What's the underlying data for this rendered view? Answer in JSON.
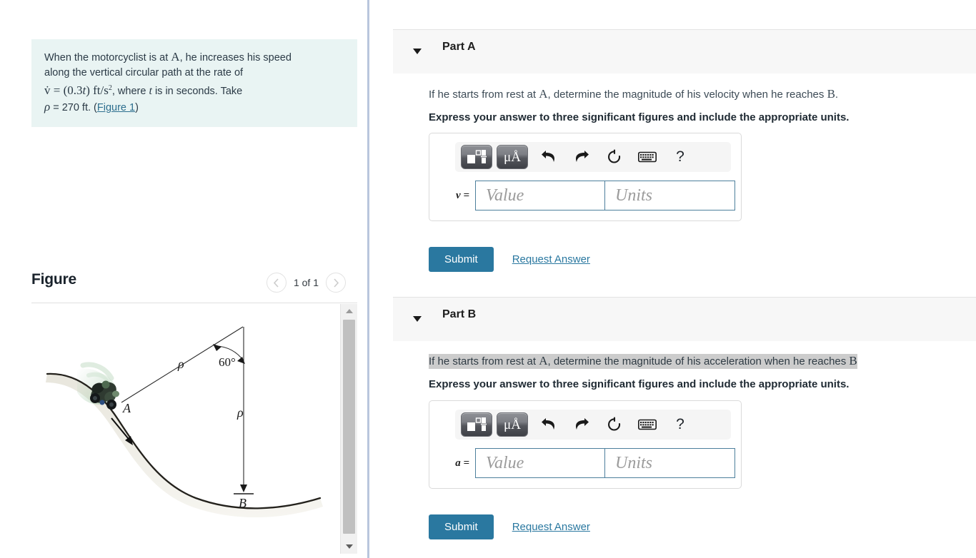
{
  "problem": {
    "line1_a": "When the motorcyclist is at ",
    "line1_A": "A",
    "line1_b": ", he increases his speed",
    "line2": "along the vertical circular path at the rate of",
    "line3_v": "v̇",
    "line3_eq": " = (0.3",
    "line3_t": "t",
    "line3_close": ")  ft/s",
    "line3_exp": "2",
    "line3_where": ", where ",
    "line3_tvar": "t",
    "line3_tail": " is in seconds. Take",
    "line4_rho": "ρ",
    "line4_val": " = 270 ft. (",
    "line4_link": "Figure 1",
    "line4_end": ")"
  },
  "figure": {
    "title": "Figure",
    "pager_label": "1 of 1",
    "prev_icon": "chevron-left-icon",
    "next_icon": "chevron-right-icon",
    "labels": {
      "point_a": "A",
      "point_b": "B",
      "rho_upper": "ρ",
      "rho_lower": "ρ",
      "angle": "60°"
    }
  },
  "scrollbar": {
    "up_icon": "triangle-up-icon",
    "down_icon": "triangle-down-icon"
  },
  "toolbar": {
    "template_icon": "math-template-icon",
    "units_icon": "μÅ",
    "undo_icon": "undo-arrow-icon",
    "redo_icon": "redo-arrow-icon",
    "reset_icon": "reset-circular-arrow-icon",
    "keyboard_icon": "keyboard-icon",
    "help_icon": "?"
  },
  "parts": [
    {
      "label": "Part A",
      "caret_icon": "caret-down-icon",
      "question_prefix": "If he starts from rest at ",
      "question_A": "A",
      "question_mid": ", determine the magnitude of his velocity when he reaches ",
      "question_B": "B",
      "question_end": ".",
      "highlighted": false,
      "instruction": "Express your answer to three significant figures and include the appropriate units.",
      "eq_label": "v =",
      "value_placeholder": "Value",
      "units_placeholder": "Units",
      "submit_label": "Submit",
      "request_label": "Request Answer"
    },
    {
      "label": "Part B",
      "caret_icon": "caret-down-icon",
      "question_prefix": "If he starts from rest at ",
      "question_A": "A",
      "question_mid": ", determine the magnitude of his acceleration when he reaches ",
      "question_B": "B",
      "question_end": ".",
      "highlighted": true,
      "instruction": "Express your answer to three significant figures and include the appropriate units.",
      "eq_label": "a =",
      "value_placeholder": "Value",
      "units_placeholder": "Units",
      "submit_label": "Submit",
      "request_label": "Request Answer"
    }
  ],
  "colors": {
    "accent": "#2a78a0",
    "problem_bg": "#e9f4f3",
    "part_header_bg": "#f7f7f7",
    "input_border": "#4d7f9c",
    "highlight": "#cccccc",
    "divider": "#b9c6dd"
  }
}
